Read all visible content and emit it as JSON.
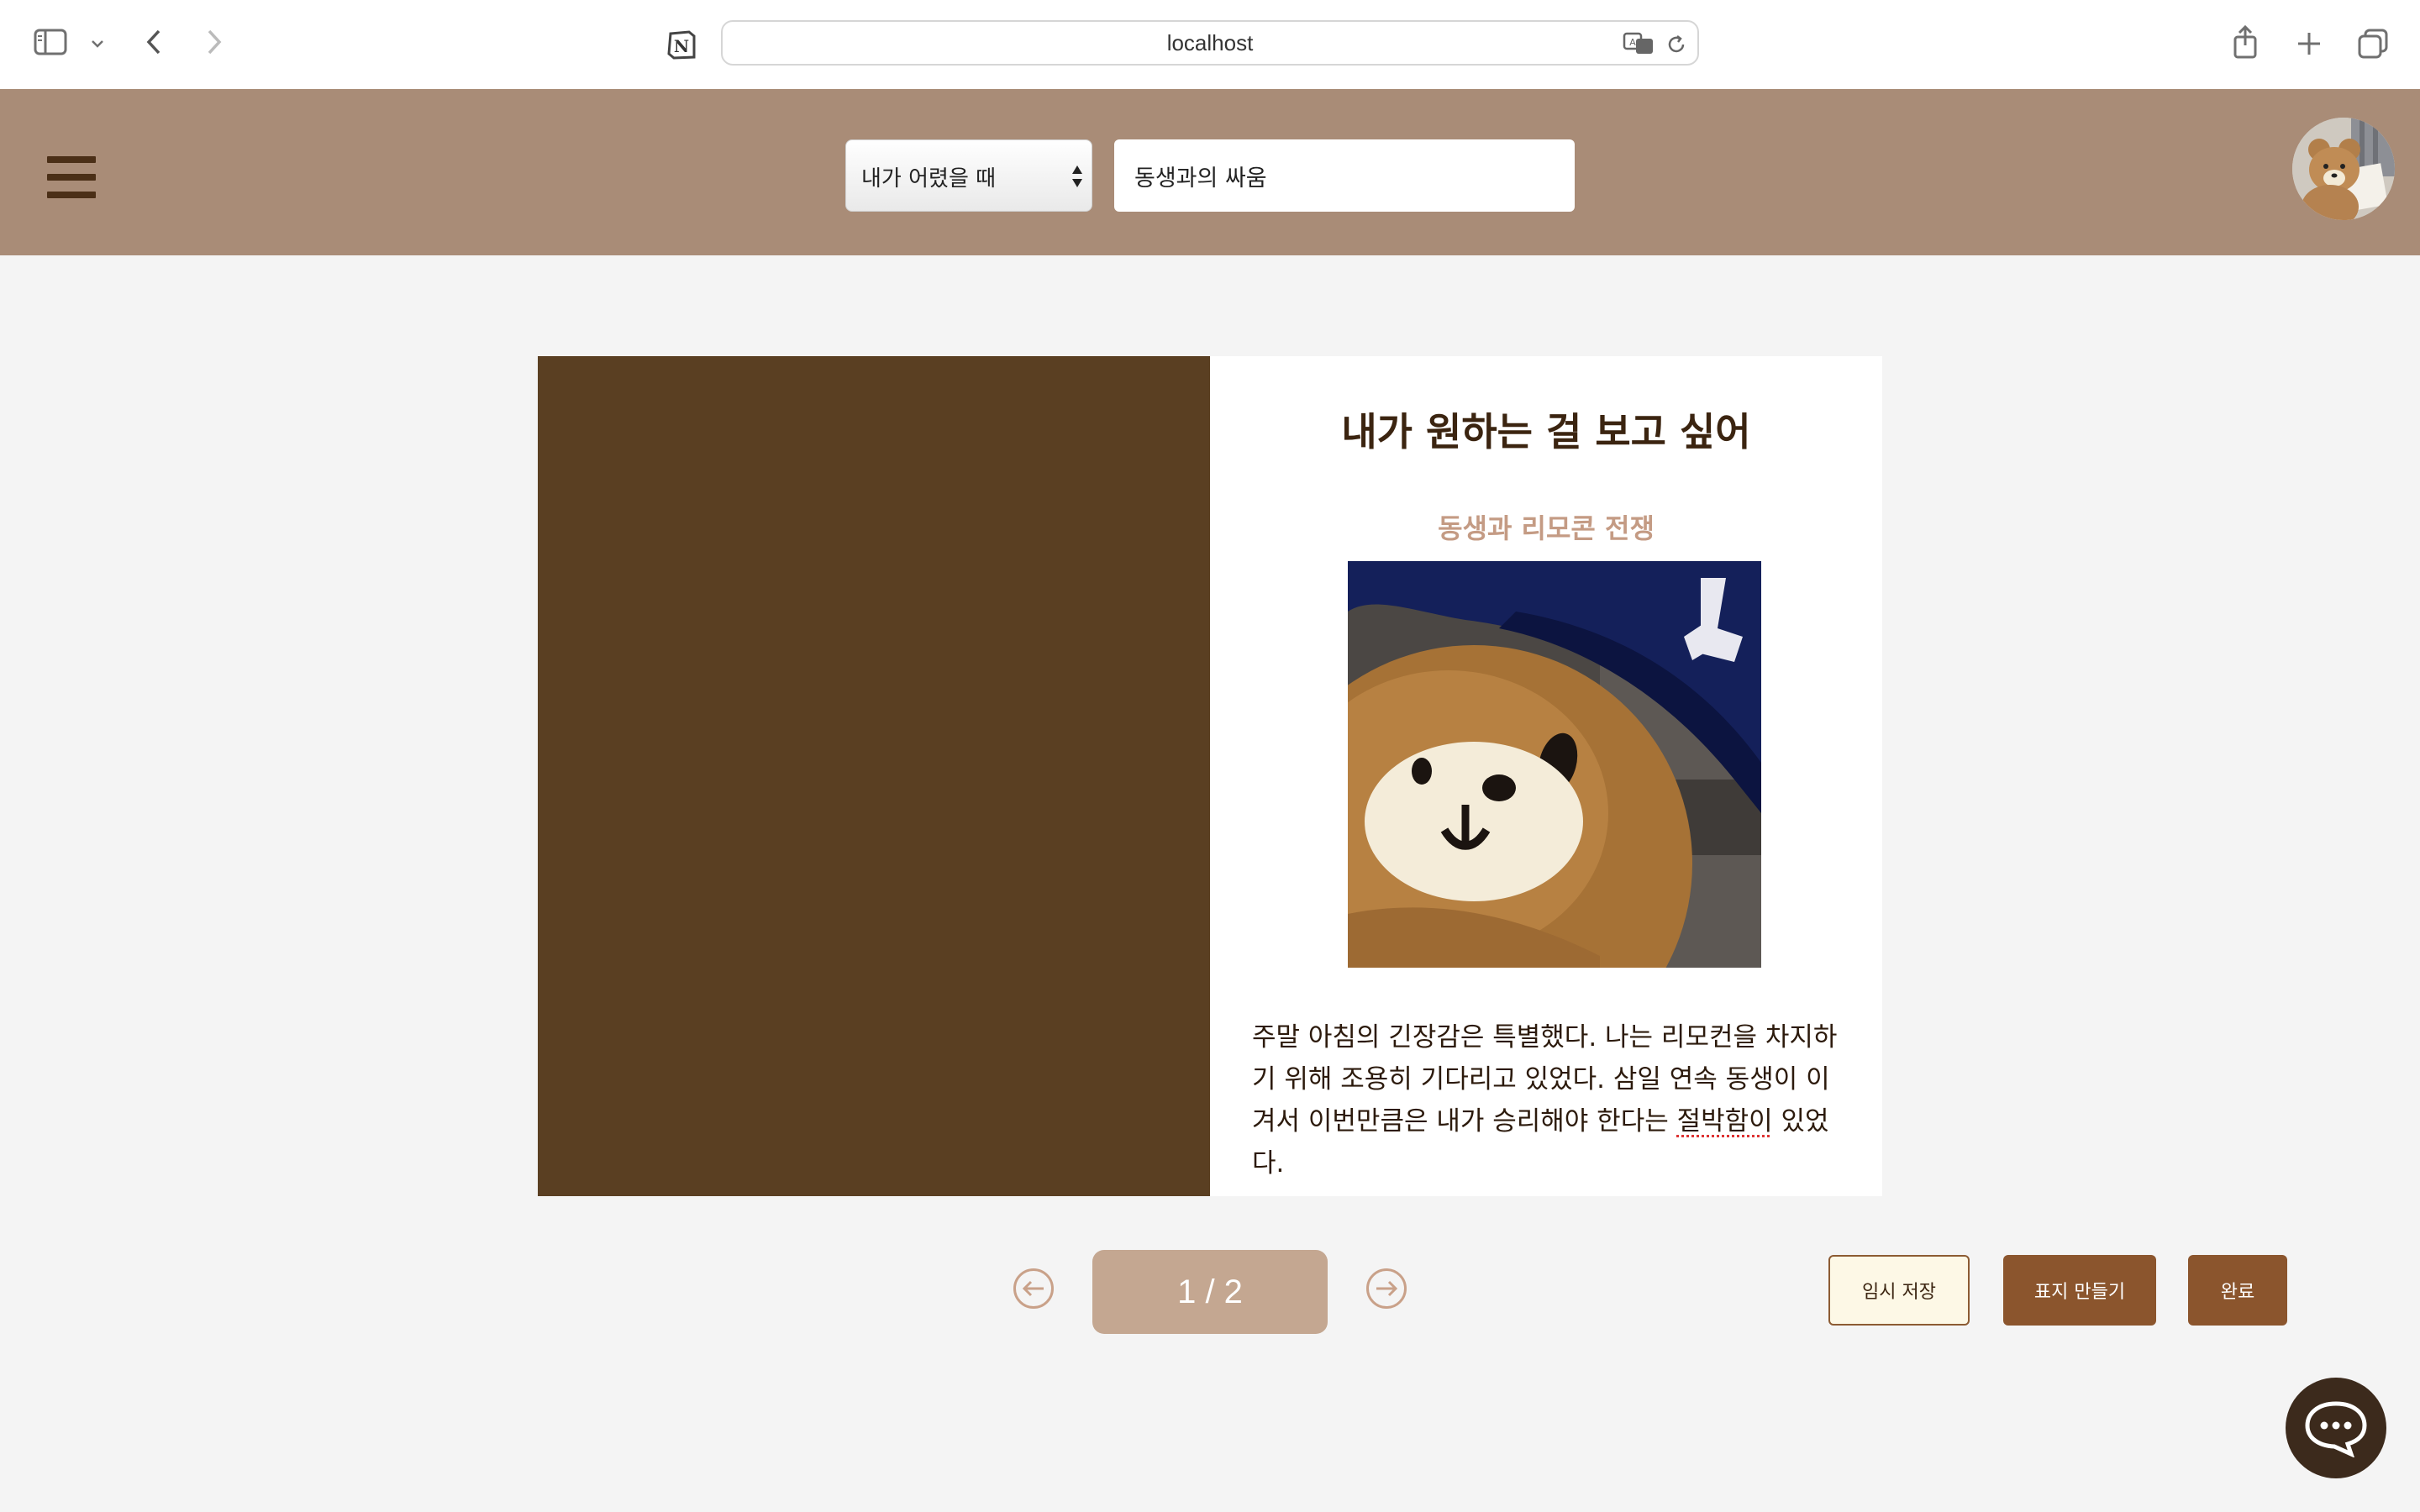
{
  "browser": {
    "url": "localhost",
    "icons": [
      "sidebar-icon",
      "chevron-down-icon",
      "back-icon",
      "forward-icon",
      "notion-icon",
      "translate-icon",
      "reload-icon",
      "share-icon",
      "new-tab-icon",
      "tabs-overview-icon"
    ]
  },
  "header": {
    "category_selected": "내가 어렸을 때",
    "topic_value": "동생과의 싸움",
    "icons": [
      "hamburger-menu-icon",
      "avatar"
    ]
  },
  "page": {
    "title": "내가 원하는 걸 보고 싶어",
    "subtitle": "동생과 리모콘 전쟁",
    "body_before": "주말 아침의 긴장감은 특별했다. 나는 리모컨을 차지하기 위해 조용히 기다리고 있었다. 삼일 연속 동생이 이겨서 이번만큼은 내가 승리해야 한다는 ",
    "body_flagged": "절박함이",
    "body_after": " 있었다."
  },
  "pager": {
    "indicator": "1 / 2",
    "icons": [
      "arrow-left-icon",
      "arrow-right-icon"
    ]
  },
  "actions": {
    "save_draft": "임시 저장",
    "make_cover": "표지 만들기",
    "done": "완료"
  },
  "colors": {
    "header_bg": "#a98c77",
    "left_page": "#5a3f22",
    "accent_brown": "#8b552d",
    "subtitle": "#c49b84",
    "pager": "#c4a791"
  }
}
